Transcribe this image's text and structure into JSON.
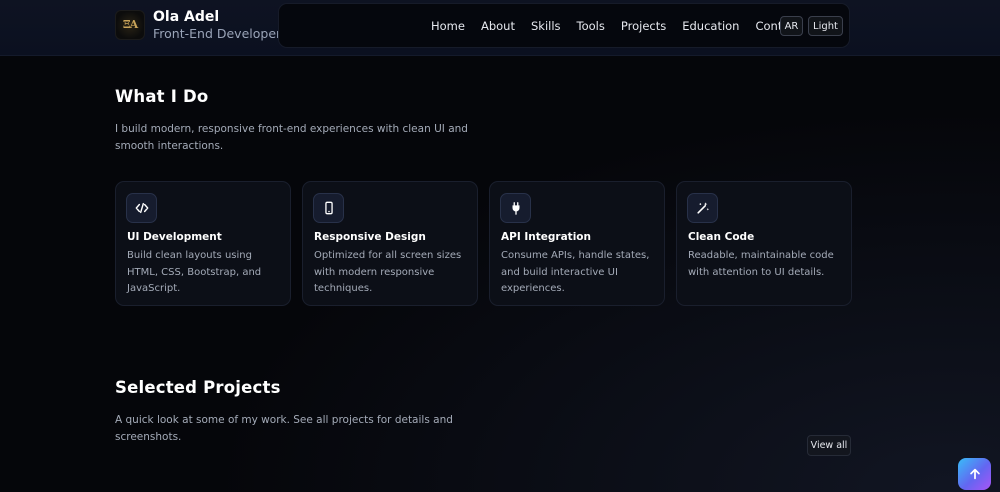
{
  "brand": {
    "logo_text": "ΞA",
    "name": "Ola Adel",
    "role": "Front-End Developer"
  },
  "nav": {
    "items": [
      "Home",
      "About",
      "Skills",
      "Tools",
      "Projects",
      "Education",
      "Contact"
    ]
  },
  "controls": {
    "lang_label": "AR",
    "theme_label": "Light"
  },
  "what_i_do": {
    "title": "What I Do",
    "lead": "I build modern, responsive front-end experiences with clean UI and smooth interactions.",
    "cards": [
      {
        "icon": "code-icon",
        "title": "UI Development",
        "desc": "Build clean layouts using HTML, CSS, Bootstrap, and JavaScript."
      },
      {
        "icon": "mobile-icon",
        "title": "Responsive Design",
        "desc": "Optimized for all screen sizes with modern responsive techniques."
      },
      {
        "icon": "plug-icon",
        "title": "API Integration",
        "desc": "Consume APIs, handle states, and build interactive UI experiences."
      },
      {
        "icon": "magic-wand-icon",
        "title": "Clean Code",
        "desc": "Readable, maintainable code with attention to UI details."
      }
    ]
  },
  "projects": {
    "title": "Selected Projects",
    "lead": "A quick look at some of my work. See all projects for details and screenshots.",
    "view_all_label": "View all"
  },
  "colors": {
    "background": "#05060a",
    "card": "#0c0f17",
    "accent_start": "#38bdf8",
    "accent_end": "#a855f7"
  }
}
